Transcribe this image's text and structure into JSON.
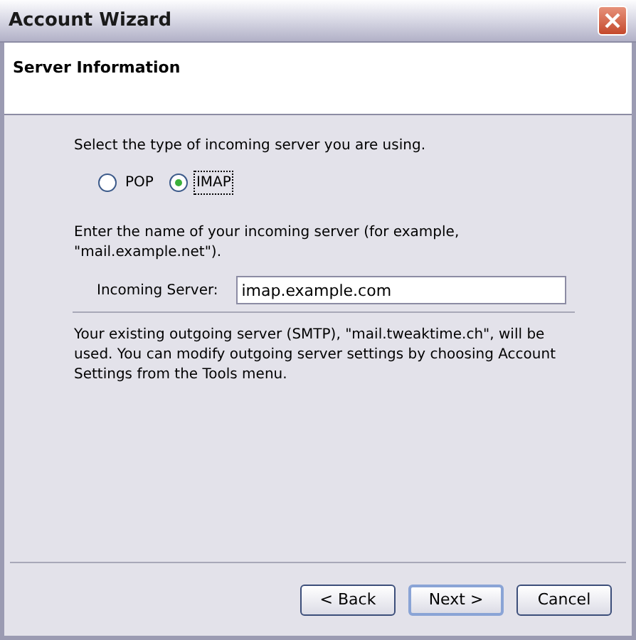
{
  "window": {
    "title": "Account Wizard"
  },
  "header": {
    "title": "Server Information"
  },
  "server_type": {
    "prompt": "Select the type of incoming server you are using.",
    "options": [
      {
        "label": "POP",
        "selected": false
      },
      {
        "label": "IMAP",
        "selected": true
      }
    ]
  },
  "server_name": {
    "prompt": "Enter the name of your incoming server (for example, \"mail.example.net\").",
    "label": "Incoming Server:",
    "value": "imap.example.com"
  },
  "note": "Your existing outgoing server (SMTP), \"mail.tweaktime.ch\", will be used. You can modify outgoing server settings by choosing Account Settings from the Tools menu.",
  "buttons": [
    {
      "label": "< Back",
      "default": false
    },
    {
      "label": "Next >",
      "default": true
    },
    {
      "label": "Cancel",
      "default": false
    }
  ]
}
